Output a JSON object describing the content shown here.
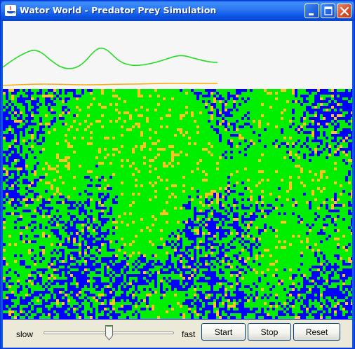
{
  "window": {
    "title": "Wator World - Predator Prey Simulation",
    "buttons": [
      "minimize-icon",
      "maximize-icon",
      "close-icon"
    ]
  },
  "colors": {
    "water": "#0000ff",
    "fish": "#00ee00",
    "shark": "#ffc020",
    "fish_line": "#22dd22",
    "shark_line": "#ffaa00"
  },
  "controls": {
    "slow_label": "slow",
    "fast_label": "fast",
    "speed": 0.5,
    "start_label": "Start",
    "stop_label": "Stop",
    "reset_label": "Reset"
  }
}
